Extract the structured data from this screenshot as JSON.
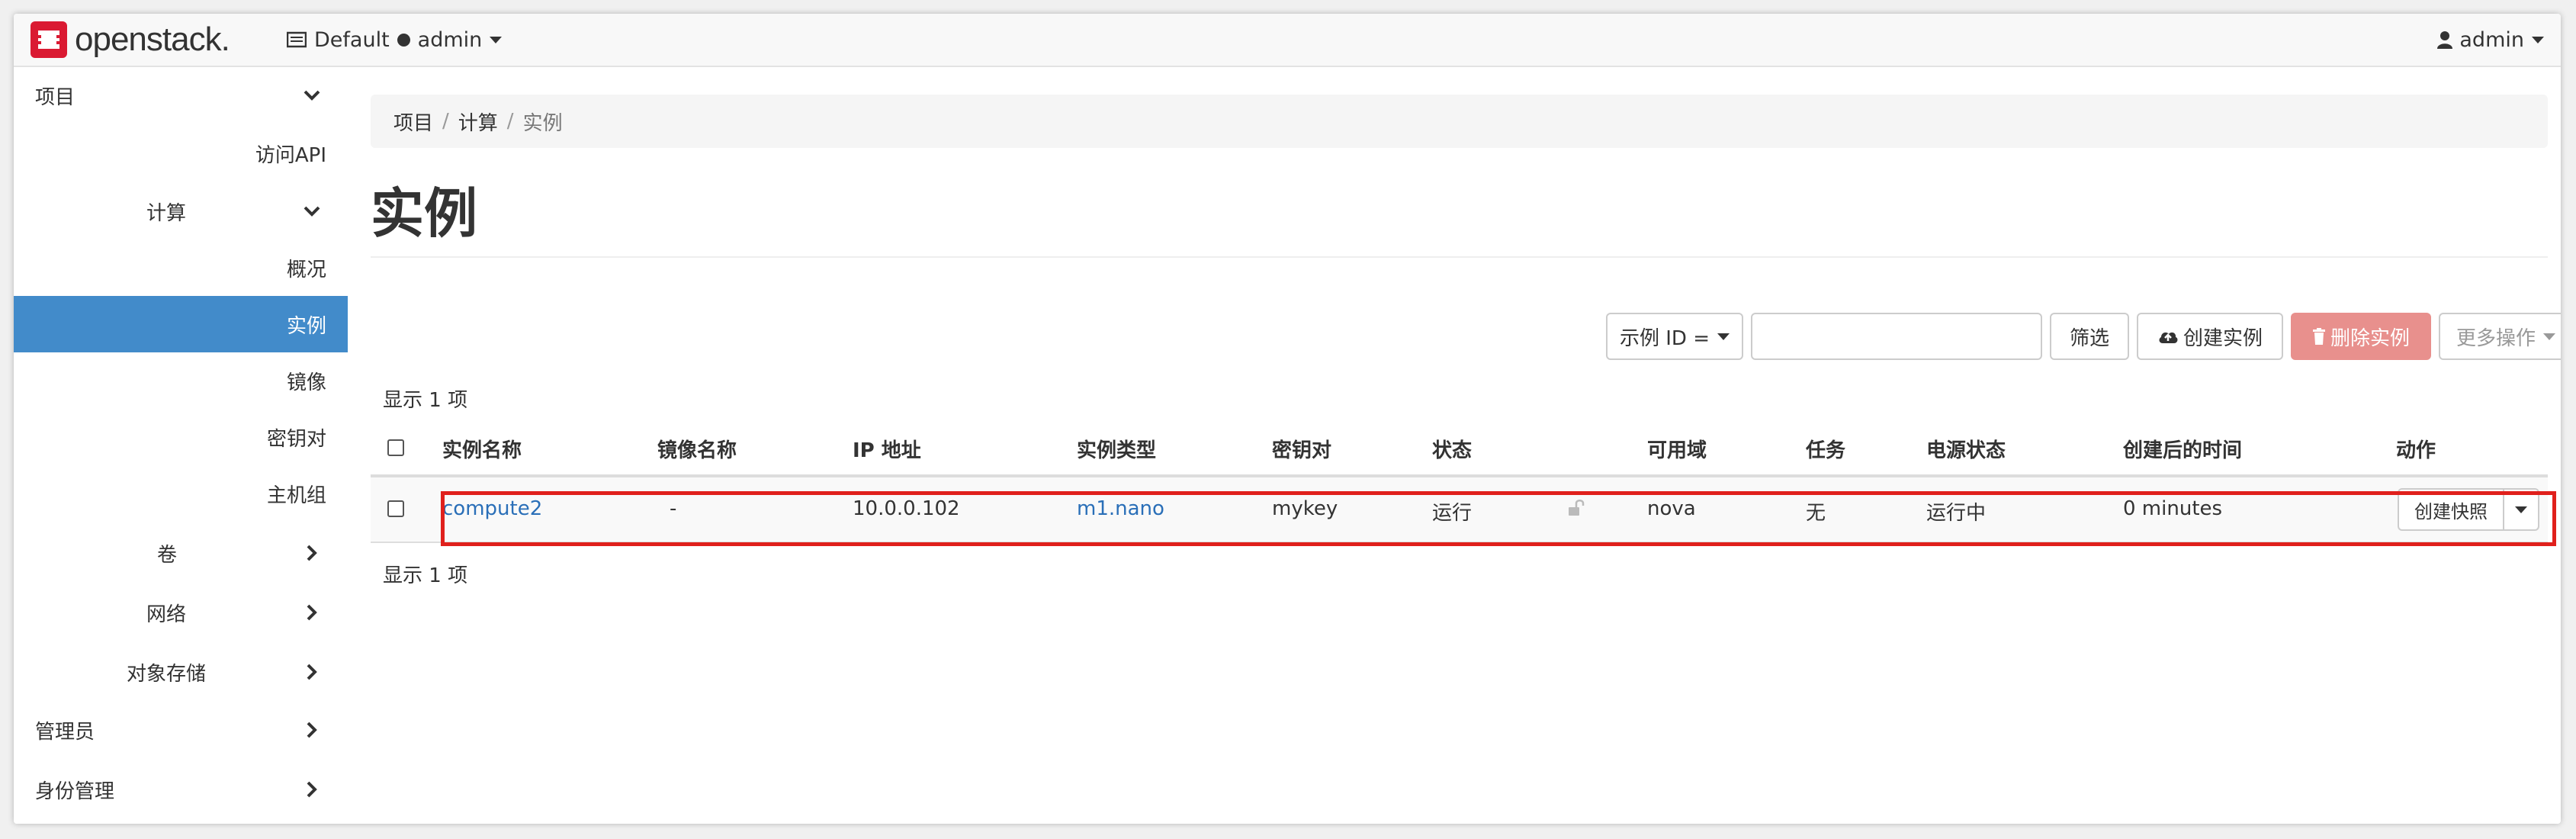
{
  "topbar": {
    "brand": "openstack.",
    "domain": "Default",
    "project": "admin",
    "user": "admin"
  },
  "sidebar": {
    "project": "项目",
    "access_api": "访问API",
    "compute": "计算",
    "overview": "概况",
    "instances": "实例",
    "images": "镜像",
    "keypairs": "密钥对",
    "server_groups": "主机组",
    "volumes": "卷",
    "network": "网络",
    "object_store": "对象存储",
    "admin": "管理员",
    "identity": "身份管理"
  },
  "breadcrumb": {
    "items": [
      "项目",
      "计算",
      "实例"
    ],
    "separator": "/"
  },
  "page": {
    "title": "实例"
  },
  "toolbar": {
    "filter_field": "示例 ID =",
    "filter_value": "",
    "filter_button": "筛选",
    "create_button": "创建实例",
    "delete_button": "删除实例",
    "more_button": "更多操作"
  },
  "summary": {
    "top": "显示 1 项",
    "bottom": "显示 1 项"
  },
  "table": {
    "headers": [
      "实例名称",
      "镜像名称",
      "IP 地址",
      "实例类型",
      "密钥对",
      "状态",
      "可用域",
      "任务",
      "电源状态",
      "创建后的时间",
      "动作"
    ],
    "rows": [
      {
        "name": "compute2",
        "image": "-",
        "ip": "10.0.0.102",
        "flavor": "m1.nano",
        "keypair": "mykey",
        "status": "运行",
        "az": "nova",
        "task": "无",
        "power": "运行中",
        "age": "0 minutes",
        "action": "创建快照"
      }
    ]
  },
  "colors": {
    "active_nav": "#428bca",
    "link": "#2a6fb8",
    "danger": "#e8908d",
    "highlight": "#e0201c",
    "brand_red": "#da1a32"
  }
}
